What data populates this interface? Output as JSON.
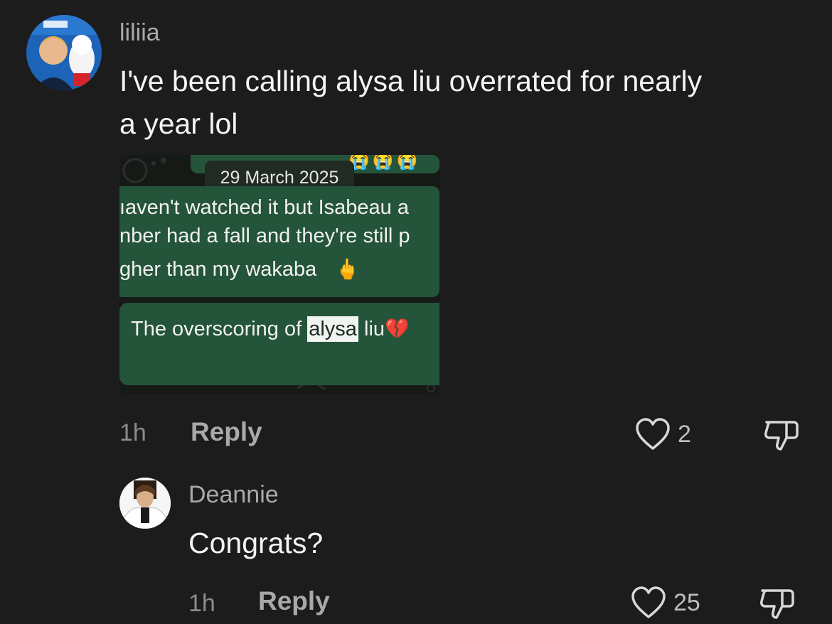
{
  "comments": [
    {
      "username": "liliia",
      "text_line1": "I've been calling alysa liu overrated for nearly",
      "text_line2": "a year lol",
      "time": "1h",
      "reply_label": "Reply",
      "likes": "2",
      "attachment": {
        "date": "29 March 2025",
        "msg1_line1": "ıaven't watched it but Isabeau a",
        "msg1_line2": "nber had a fall and they're still p",
        "msg1_line3": "gher than my wakaba",
        "msg1_emoji": "🖕",
        "msg2_before": "The overscoring of ",
        "msg2_highlight": "alysa",
        "msg2_after": " liu",
        "msg2_emoji": "💔"
      }
    },
    {
      "username": "Deannie",
      "text": "Congrats?",
      "time": "1h",
      "reply_label": "Reply",
      "likes": "25"
    }
  ],
  "colors": {
    "background": "#1c1c1c",
    "bubble_green": "#24543a",
    "muted_text": "#a9a9a9"
  },
  "icons": [
    "heart-icon",
    "dislike-icon",
    "avatar"
  ]
}
